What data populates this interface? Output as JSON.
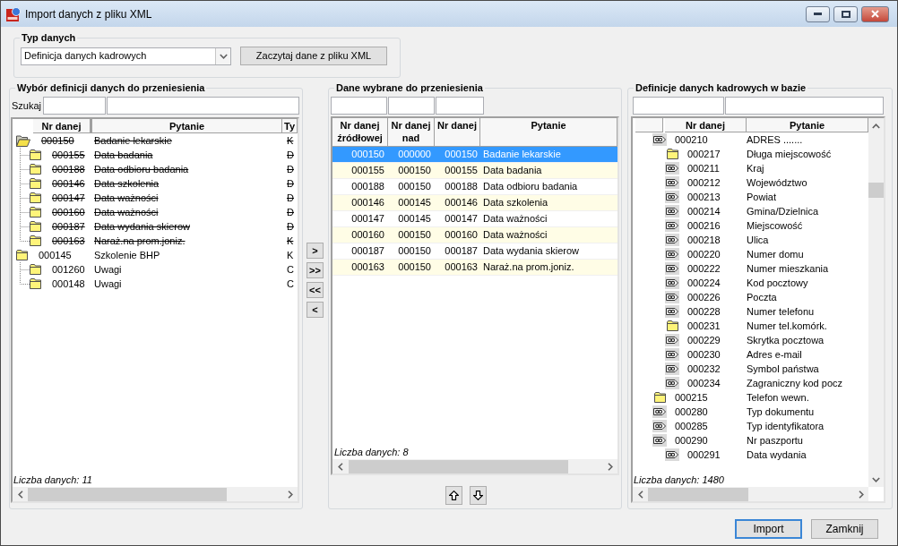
{
  "window": {
    "title": "Import danych z pliku XML"
  },
  "data_type": {
    "label": "Typ danych",
    "dropdown": {
      "value": "Definicja danych kadrowych"
    },
    "load_button": {
      "label": "Zaczytaj dane z pliku XML"
    }
  },
  "source_panel": {
    "title": "Wybór definicji danych do przeniesienia",
    "search_label": "Szukaj",
    "columns": [
      "Nr danej",
      "Pytanie",
      "Ty"
    ],
    "tree": [
      {
        "number": "000150",
        "question": "Badanie lekarskie",
        "column_3": "K",
        "struck": true,
        "open": true,
        "children": [
          {
            "number": "000155",
            "question": "Data badania",
            "column_3": "D",
            "struck": true,
            "open": false
          },
          {
            "number": "000188",
            "question": "Data odbioru badania",
            "column_3": "D",
            "struck": true,
            "open": false
          },
          {
            "number": "000146",
            "question": "Data szkolenia",
            "column_3": "D",
            "struck": true,
            "open": false
          },
          {
            "number": "000147",
            "question": "Data ważności",
            "column_3": "D",
            "struck": true,
            "open": false
          },
          {
            "number": "000160",
            "question": "Data ważności",
            "column_3": "D",
            "struck": true,
            "open": false
          },
          {
            "number": "000187",
            "question": "Data wydania skierow",
            "column_3": "D",
            "struck": true,
            "open": false
          },
          {
            "number": "000163",
            "question": "Naraż.na prom.joniz.",
            "column_3": "K",
            "struck": true,
            "open": false
          }
        ]
      },
      {
        "number": "000145",
        "question": "Szkolenie BHP",
        "column_3": "K",
        "struck": false,
        "open": false,
        "children": [
          {
            "number": "001260",
            "question": "Uwagi",
            "column_3": "C",
            "struck": false,
            "open": false
          },
          {
            "number": "000148",
            "question": "Uwagi",
            "column_3": "C",
            "struck": false,
            "open": false
          }
        ]
      }
    ],
    "count": "Liczba danych: 11"
  },
  "transfer_buttons": [
    {
      "label": ">"
    },
    {
      "label": ">>"
    },
    {
      "label": "<<"
    },
    {
      "label": "<"
    }
  ],
  "selected_panel": {
    "title": "Dane wybrane do przeniesienia",
    "columns": [
      "Nr danej źródłowej",
      "Nr danej nad",
      "Nr danej",
      "Pytanie"
    ],
    "rows": [
      {
        "source_number": "000150",
        "parent_number": "000000",
        "number": "000150",
        "question": "Badanie lekarskie",
        "selected": true
      },
      {
        "source_number": "000155",
        "parent_number": "000150",
        "number": "000155",
        "question": "Data badania",
        "selected": false
      },
      {
        "source_number": "000188",
        "parent_number": "000150",
        "number": "000188",
        "question": "Data odbioru badania",
        "selected": false
      },
      {
        "source_number": "000146",
        "parent_number": "000145",
        "number": "000146",
        "question": "Data szkolenia",
        "selected": false
      },
      {
        "source_number": "000147",
        "parent_number": "000145",
        "number": "000147",
        "question": "Data ważności",
        "selected": false
      },
      {
        "source_number": "000160",
        "parent_number": "000150",
        "number": "000160",
        "question": "Data ważności",
        "selected": false
      },
      {
        "source_number": "000187",
        "parent_number": "000150",
        "number": "000187",
        "question": "Data wydania skierow",
        "selected": false
      },
      {
        "source_number": "000163",
        "parent_number": "000150",
        "number": "000163",
        "question": "Naraż.na prom.joniz.",
        "selected": false
      }
    ],
    "count": "Liczba danych: 8"
  },
  "database_panel": {
    "title": "Definicje danych kadrowych w bazie",
    "columns": [
      "Nr danej",
      "Pytanie"
    ],
    "tree": [
      {
        "kind": "tag",
        "number": "000210",
        "question": "ADRES .......",
        "children": [
          {
            "kind": "folder",
            "number": "000217",
            "question": "Długa miejscowość"
          },
          {
            "kind": "tag",
            "number": "000211",
            "question": "Kraj"
          },
          {
            "kind": "tag",
            "number": "000212",
            "question": "Województwo"
          },
          {
            "kind": "tag",
            "number": "000213",
            "question": "Powiat"
          },
          {
            "kind": "tag",
            "number": "000214",
            "question": "Gmina/Dzielnica"
          },
          {
            "kind": "tag",
            "number": "000216",
            "question": "Miejscowość"
          },
          {
            "kind": "tag",
            "number": "000218",
            "question": "Ulica"
          },
          {
            "kind": "tag",
            "number": "000220",
            "question": "Numer domu"
          },
          {
            "kind": "tag",
            "number": "000222",
            "question": "Numer mieszkania"
          },
          {
            "kind": "tag",
            "number": "000224",
            "question": "Kod pocztowy"
          },
          {
            "kind": "tag",
            "number": "000226",
            "question": "Poczta"
          },
          {
            "kind": "tag",
            "number": "000228",
            "question": "Numer telefonu"
          },
          {
            "kind": "folder",
            "number": "000231",
            "question": "Numer tel.komórk."
          },
          {
            "kind": "tag",
            "number": "000229",
            "question": "Skrytka pocztowa"
          },
          {
            "kind": "tag",
            "number": "000230",
            "question": "Adres e-mail"
          },
          {
            "kind": "tag",
            "number": "000232",
            "question": "Symbol państwa"
          },
          {
            "kind": "tag",
            "number": "000234",
            "question": "Zagraniczny kod pocz"
          }
        ]
      },
      {
        "kind": "folder",
        "number": "000215",
        "question": "Telefon wewn."
      },
      {
        "kind": "tag",
        "number": "000280",
        "question": "Typ dokumentu"
      },
      {
        "kind": "tag",
        "number": "000285",
        "question": "Typ identyfikatora"
      },
      {
        "kind": "tag",
        "number": "000290",
        "question": "Nr paszportu",
        "children": [
          {
            "kind": "tag",
            "number": "000291",
            "question": "Data wydania"
          }
        ]
      }
    ],
    "count": "Liczba danych: 1480"
  },
  "buttons": [
    {
      "label": "Import",
      "focused": true
    },
    {
      "label": "Zamknij",
      "focused": false
    }
  ]
}
